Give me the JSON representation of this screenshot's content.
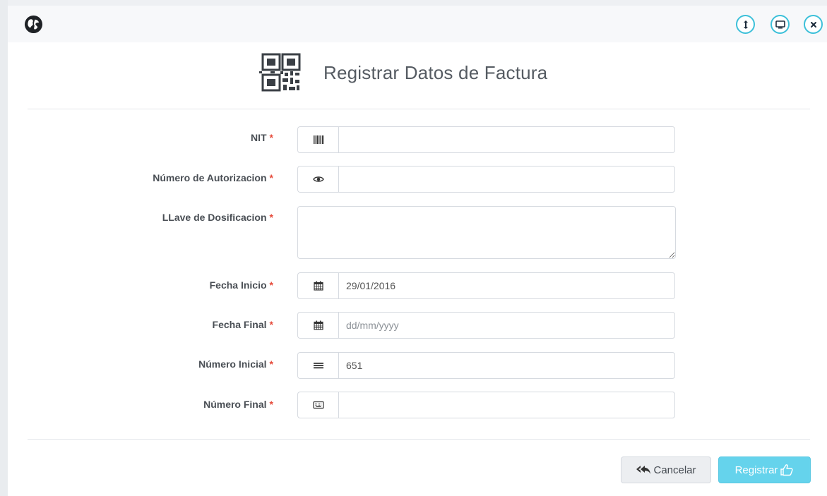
{
  "window": {
    "title_icon": "globe-icon",
    "buttons": [
      {
        "name": "resize-vertical-icon"
      },
      {
        "name": "monitor-icon"
      },
      {
        "name": "close-icon"
      }
    ]
  },
  "header": {
    "icon": "qr-code-icon",
    "title": "Registrar Datos de Factura"
  },
  "form": {
    "required_mark": "*",
    "nit": {
      "label": "NIT",
      "icon": "barcode-icon",
      "value": "",
      "placeholder": ""
    },
    "autorizacion": {
      "label": "Número de Autorizacion",
      "icon": "eye-icon",
      "value": "",
      "placeholder": ""
    },
    "llave": {
      "label": "LLave de Dosificacion",
      "value": ""
    },
    "fecha_inicio": {
      "label": "Fecha Inicio",
      "icon": "calendar-icon",
      "value": "29/01/2016",
      "placeholder": ""
    },
    "fecha_final": {
      "label": "Fecha Final",
      "icon": "calendar-icon",
      "value": "",
      "placeholder": "dd/mm/yyyy"
    },
    "numero_inicial": {
      "label": "Número Inicial",
      "icon": "list-icon",
      "value": "651",
      "placeholder": ""
    },
    "numero_final": {
      "label": "Número Final",
      "icon": "keyboard-icon",
      "value": "",
      "placeholder": ""
    }
  },
  "actions": {
    "cancel_label": "Cancelar",
    "cancel_icon": "reply-all-icon",
    "register_label": "Registrar",
    "register_icon": "thumbs-up-icon"
  },
  "colors": {
    "accent": "#3cc0d9",
    "register_button": "#65d3ec",
    "required": "#e64b3b",
    "title_text": "#555b62"
  }
}
